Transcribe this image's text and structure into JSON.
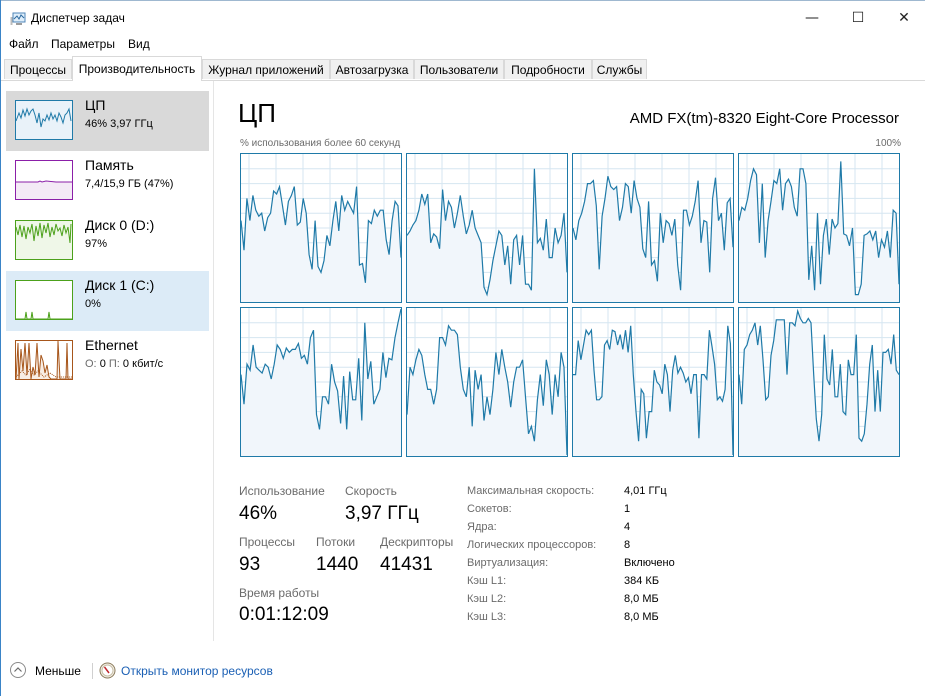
{
  "window": {
    "title": "Диспетчер задач",
    "controls": {
      "minimize": "—",
      "maximize": "☐",
      "close": "✕"
    }
  },
  "menu": [
    "Файл",
    "Параметры",
    "Вид"
  ],
  "tabs": [
    {
      "label": "Процессы",
      "active": false
    },
    {
      "label": "Производительность",
      "active": true
    },
    {
      "label": "Журнал приложений",
      "active": false
    },
    {
      "label": "Автозагрузка",
      "active": false
    },
    {
      "label": "Пользователи",
      "active": false
    },
    {
      "label": "Подробности",
      "active": false
    },
    {
      "label": "Службы",
      "active": false
    }
  ],
  "sidebar": {
    "items": [
      {
        "name": "ЦП",
        "sub": "46%  3,97 ГГц",
        "color": "#1f7aa8",
        "fill": "#e7f1f8",
        "state": "selected"
      },
      {
        "name": "Память",
        "sub": "7,4/15,9 ГБ (47%)",
        "color": "#8b1fa8",
        "fill": "#f4eaf6",
        "state": "normal"
      },
      {
        "name": "Диск 0 (D:)",
        "sub": "97%",
        "color": "#4ca11b",
        "fill": "#eff7e8",
        "state": "normal"
      },
      {
        "name": "Диск 1 (C:)",
        "sub": "0%",
        "color": "#4ca11b",
        "fill": "#eff7e8",
        "state": "hover"
      },
      {
        "name": "Ethernet",
        "sub_prefix_o": "О:",
        "sub_o": "0",
        "sub_prefix_p": "П:",
        "sub_p": "0 кбит/с",
        "color": "#a7561b",
        "fill": "#f8ede4",
        "state": "normal"
      }
    ]
  },
  "main": {
    "title": "ЦП",
    "processor": "AMD FX(tm)-8320 Eight-Core Processor",
    "axis_left": "% использования более 60 секунд",
    "axis_right": "100%",
    "line_color": "#1f7aa8",
    "fill_color": "#f1f6fb",
    "grid_color": "#d5e6f1"
  },
  "chart_data": {
    "type": "line",
    "title": "% использования более 60 секунд",
    "ylim": [
      0,
      100
    ],
    "series": [
      {
        "name": "core-0",
        "values": [
          55,
          35,
          70,
          55,
          72,
          62,
          58,
          60,
          48,
          57,
          60,
          75,
          73,
          78,
          65,
          52,
          68,
          72,
          78,
          52,
          54,
          70,
          60,
          32,
          22,
          55,
          24,
          20,
          28,
          45,
          38,
          55,
          68,
          48,
          72,
          62,
          68,
          64,
          60,
          78,
          25,
          26,
          13,
          55,
          53,
          62,
          58,
          62,
          62,
          42,
          32,
          55,
          68,
          65,
          30
        ]
      },
      {
        "name": "core-1",
        "values": [
          45,
          48,
          52,
          55,
          62,
          73,
          66,
          73,
          40,
          46,
          44,
          36,
          76,
          55,
          68,
          64,
          50,
          60,
          72,
          58,
          46,
          52,
          62,
          50,
          45,
          40,
          10,
          5,
          15,
          28,
          38,
          48,
          45,
          25,
          38,
          12,
          42,
          45,
          25,
          45,
          12,
          12,
          8,
          90,
          40,
          43,
          35,
          56,
          30,
          30,
          50,
          40,
          45,
          60,
          20
        ]
      },
      {
        "name": "core-2",
        "values": [
          50,
          42,
          55,
          60,
          68,
          80,
          80,
          82,
          65,
          22,
          58,
          70,
          85,
          78,
          76,
          78,
          55,
          64,
          80,
          78,
          60,
          82,
          70,
          64,
          36,
          30,
          68,
          25,
          28,
          14,
          60,
          40,
          55,
          53,
          45,
          56,
          25,
          8,
          62,
          62,
          52,
          58,
          68,
          82,
          40,
          55,
          54,
          20,
          70,
          84,
          55,
          60,
          35,
          67,
          70,
          37
        ]
      },
      {
        "name": "core-3",
        "values": [
          55,
          64,
          62,
          70,
          82,
          90,
          86,
          40,
          80,
          30,
          55,
          68,
          82,
          80,
          90,
          62,
          80,
          83,
          78,
          64,
          58,
          90,
          90,
          80,
          15,
          38,
          8,
          60,
          12,
          45,
          56,
          32,
          56,
          50,
          53,
          95,
          46,
          45,
          38,
          50,
          5,
          5,
          12,
          45,
          46,
          48,
          42,
          48,
          30,
          42,
          37,
          48,
          30,
          62,
          60,
          12
        ]
      },
      {
        "name": "core-4",
        "values": [
          55,
          35,
          62,
          58,
          75,
          60,
          58,
          56,
          62,
          60,
          52,
          62,
          75,
          72,
          66,
          73,
          70,
          72,
          72,
          76,
          66,
          68,
          62,
          80,
          85,
          28,
          18,
          40,
          40,
          35,
          62,
          50,
          44,
          22,
          54,
          18,
          57,
          38,
          38,
          66,
          24,
          90,
          52,
          64,
          35,
          40,
          45,
          70,
          53,
          66,
          65,
          80,
          90,
          100
        ]
      },
      {
        "name": "core-5",
        "values": [
          28,
          60,
          55,
          65,
          72,
          68,
          55,
          45,
          45,
          35,
          45,
          80,
          80,
          75,
          88,
          85,
          85,
          82,
          60,
          45,
          40,
          60,
          20,
          58,
          45,
          55,
          24,
          40,
          28,
          45,
          70,
          55,
          72,
          60,
          50,
          33,
          50,
          60,
          60,
          65,
          40,
          15,
          20,
          10,
          38,
          55,
          34,
          65,
          55,
          28,
          55,
          40,
          70,
          60,
          0
        ]
      },
      {
        "name": "core-6",
        "values": [
          55,
          55,
          78,
          65,
          75,
          85,
          82,
          85,
          58,
          38,
          38,
          40,
          75,
          78,
          72,
          85,
          84,
          75,
          82,
          72,
          85,
          70,
          88,
          55,
          30,
          10,
          45,
          42,
          12,
          30,
          30,
          58,
          50,
          48,
          42,
          62,
          55,
          30,
          58,
          68,
          56,
          60,
          56,
          50,
          53,
          42,
          55,
          55,
          12,
          55,
          55,
          52,
          85,
          74,
          62,
          38,
          40,
          37,
          45,
          88,
          76,
          0
        ]
      },
      {
        "name": "core-7",
        "values": [
          55,
          35,
          72,
          75,
          82,
          85,
          90,
          75,
          88,
          65,
          38,
          40,
          68,
          78,
          92,
          92,
          92,
          92,
          55,
          90,
          90,
          88,
          98,
          93,
          90,
          90,
          93,
          90,
          55,
          25,
          10,
          28,
          82,
          52,
          48,
          72,
          40,
          40,
          62,
          30,
          28,
          65,
          55,
          55,
          82,
          12,
          10,
          15,
          35,
          62,
          75,
          30,
          58,
          30,
          70,
          70,
          72,
          62,
          82,
          58,
          55
        ]
      }
    ]
  },
  "stats": {
    "usage_label": "Использование",
    "usage_value": "46%",
    "speed_label": "Скорость",
    "speed_value": "3,97 ГГц",
    "processes_label": "Процессы",
    "processes_value": "93",
    "threads_label": "Потоки",
    "threads_value": "1440",
    "handles_label": "Дескрипторы",
    "handles_value": "41431",
    "uptime_label": "Время работы",
    "uptime_value": "0:01:12:09"
  },
  "info": [
    {
      "label": "Максимальная скорость:",
      "value": "4,01 ГГц"
    },
    {
      "label": "Сокетов:",
      "value": "1"
    },
    {
      "label": "Ядра:",
      "value": "4"
    },
    {
      "label": "Логических процессоров:",
      "value": "8"
    },
    {
      "label": "Виртуализация:",
      "value": "Включено"
    },
    {
      "label": "Кэш L1:",
      "value": "384 КБ"
    },
    {
      "label": "Кэш L2:",
      "value": "8,0 МБ"
    },
    {
      "label": "Кэш L3:",
      "value": "8,0 МБ"
    }
  ],
  "footer": {
    "less_label": "Меньше",
    "resmon_label": "Открыть монитор ресурсов"
  }
}
